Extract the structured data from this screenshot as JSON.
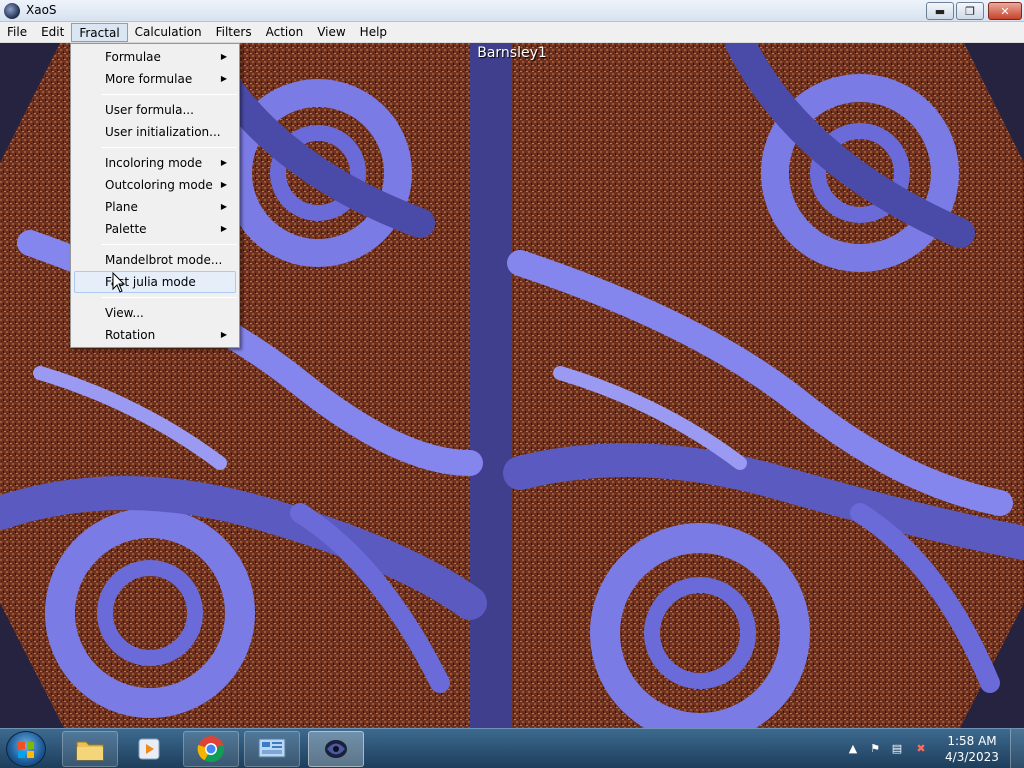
{
  "window": {
    "title": "XaoS",
    "minimize_glyph": "▬",
    "maximize_glyph": "❐",
    "close_glyph": "✕"
  },
  "menubar": [
    {
      "label": "File"
    },
    {
      "label": "Edit"
    },
    {
      "label": "Fractal",
      "active": true
    },
    {
      "label": "Calculation"
    },
    {
      "label": "Filters"
    },
    {
      "label": "Action"
    },
    {
      "label": "View"
    },
    {
      "label": "Help"
    }
  ],
  "fractal_menu": {
    "items": [
      {
        "label": "Formulae",
        "submenu": true
      },
      {
        "label": "More formulae",
        "submenu": true
      },
      {
        "separator": true
      },
      {
        "label": "User formula...",
        "submenu": false
      },
      {
        "label": "User initialization...",
        "submenu": false
      },
      {
        "separator": true
      },
      {
        "label": "Incoloring mode",
        "submenu": true
      },
      {
        "label": "Outcoloring mode",
        "submenu": true
      },
      {
        "label": "Plane",
        "submenu": true
      },
      {
        "label": "Palette",
        "submenu": true
      },
      {
        "separator": true
      },
      {
        "label": "Mandelbrot mode...",
        "submenu": false
      },
      {
        "label": "Fast julia mode",
        "submenu": false,
        "highlighted": true
      },
      {
        "separator": true
      },
      {
        "label": "View...",
        "submenu": false
      },
      {
        "label": "Rotation",
        "submenu": true
      }
    ]
  },
  "canvas": {
    "fractal_name": "Barnsley1"
  },
  "taskbar": {
    "clock_time": "1:58 AM",
    "clock_date": "4/3/2023"
  },
  "colors": {
    "fractal_purple": "#7b7be6",
    "fractal_dark_purple": "#4a4aa8",
    "fractal_brown": "#7a3a22",
    "menu_highlight": "#e5eef9"
  }
}
